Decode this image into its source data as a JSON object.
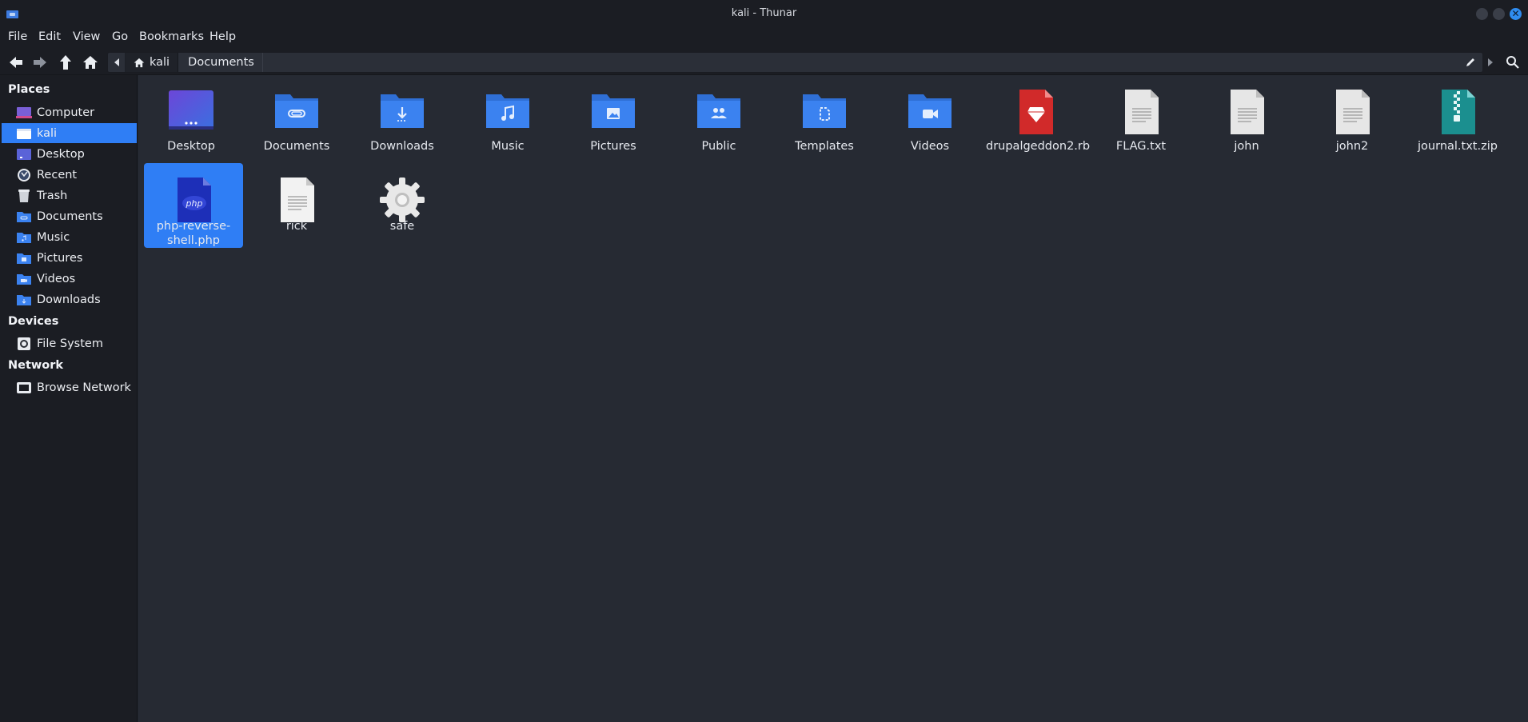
{
  "window": {
    "title": "kali - Thunar"
  },
  "menu": [
    "File",
    "Edit",
    "View",
    "Go",
    "Bookmarks",
    "Help"
  ],
  "pathbar": {
    "crumbs": [
      "kali",
      "Documents"
    ]
  },
  "sidebar": {
    "sections": [
      {
        "title": "Places",
        "items": [
          "Computer",
          "kali",
          "Desktop",
          "Recent",
          "Trash",
          "Documents",
          "Music",
          "Pictures",
          "Videos",
          "Downloads"
        ]
      },
      {
        "title": "Devices",
        "items": [
          "File System"
        ]
      },
      {
        "title": "Network",
        "items": [
          "Browse Network"
        ]
      }
    ],
    "selected": "kali"
  },
  "files": [
    {
      "name": "Desktop",
      "icon": "desktop-folder-icon"
    },
    {
      "name": "Documents",
      "icon": "documents-folder-icon"
    },
    {
      "name": "Downloads",
      "icon": "downloads-folder-icon"
    },
    {
      "name": "Music",
      "icon": "music-folder-icon"
    },
    {
      "name": "Pictures",
      "icon": "pictures-folder-icon"
    },
    {
      "name": "Public",
      "icon": "public-folder-icon"
    },
    {
      "name": "Templates",
      "icon": "templates-folder-icon"
    },
    {
      "name": "Videos",
      "icon": "videos-folder-icon"
    },
    {
      "name": "drupalgeddon2.rb",
      "icon": "ruby-file-icon"
    },
    {
      "name": "FLAG.txt",
      "icon": "text-file-icon"
    },
    {
      "name": "john",
      "icon": "text-file-icon"
    },
    {
      "name": "john2",
      "icon": "text-file-icon"
    },
    {
      "name": "journal.txt.zip",
      "icon": "zip-archive-icon"
    },
    {
      "name": "php-reverse-shell.php",
      "icon": "php-file-icon",
      "selected": true
    },
    {
      "name": "rick",
      "icon": "text-file-icon"
    },
    {
      "name": "safe",
      "icon": "executable-gear-icon"
    }
  ],
  "colors": {
    "accent": "#2f7ef5",
    "folder": "#3b82f0",
    "background": "#262a33",
    "sidebar": "#1b1d23"
  }
}
